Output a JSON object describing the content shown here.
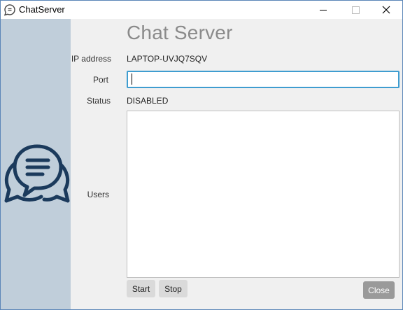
{
  "window": {
    "title": "ChatServer",
    "controls": {
      "minimize_icon": "minimize-icon",
      "maximize_icon": "maximize-icon",
      "close_icon": "close-icon"
    }
  },
  "sidebar": {
    "logo_icon": "chat-bubbles-icon",
    "color": "#c0ceda",
    "logo_color": "#1b3a5c"
  },
  "heading": "Chat Server",
  "form": {
    "ip_label": "IP address",
    "ip_value": "LAPTOP-UVJQ7SQV",
    "port_label": "Port",
    "port_value": "",
    "port_placeholder": "",
    "status_label": "Status",
    "status_value": "DISABLED",
    "users_label": "Users",
    "users": []
  },
  "buttons": {
    "start": "Start",
    "stop": "Stop",
    "close": "Close"
  },
  "colors": {
    "accent": "#3f9dd0",
    "heading": "#8a8a8a"
  }
}
